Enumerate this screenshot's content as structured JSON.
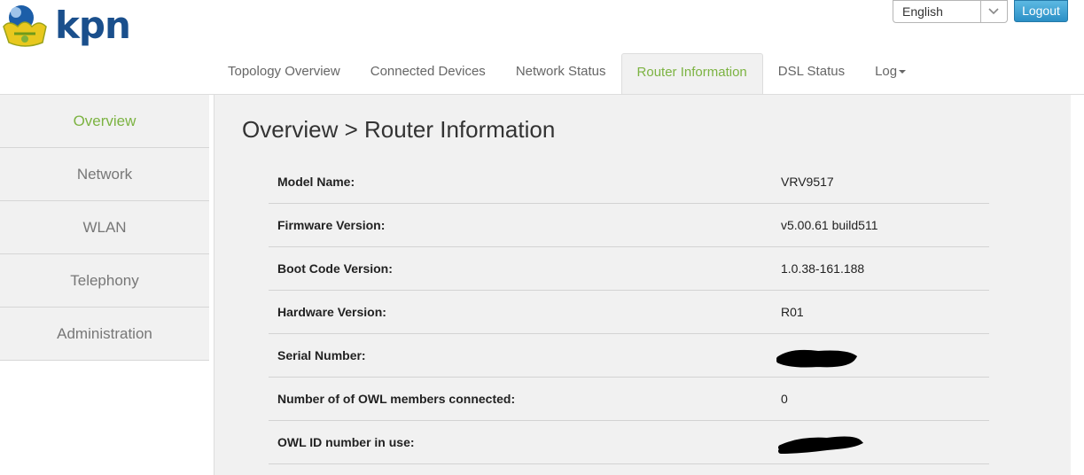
{
  "brand": {
    "name": "kpn"
  },
  "language": {
    "selected": "English"
  },
  "logout_label": "Logout",
  "tabs": [
    {
      "label": "Topology Overview"
    },
    {
      "label": "Connected Devices"
    },
    {
      "label": "Network Status"
    },
    {
      "label": "Router Information",
      "active": true
    },
    {
      "label": "DSL Status"
    },
    {
      "label": "Log"
    }
  ],
  "sidebar": {
    "items": [
      {
        "label": "Overview",
        "active": true
      },
      {
        "label": "Network"
      },
      {
        "label": "WLAN"
      },
      {
        "label": "Telephony"
      },
      {
        "label": "Administration"
      }
    ]
  },
  "page_title": "Overview > Router Information",
  "router_info": [
    {
      "label": "Model Name:",
      "value": "VRV9517"
    },
    {
      "label": "Firmware Version:",
      "value": "v5.00.61 build511"
    },
    {
      "label": "Boot Code Version:",
      "value": "1.0.38-161.188"
    },
    {
      "label": "Hardware Version:",
      "value": "R01"
    },
    {
      "label": "Serial Number:",
      "value": "",
      "redacted": true
    },
    {
      "label": "Number of of OWL members connected:",
      "value": "0"
    },
    {
      "label": "OWL ID number in use:",
      "value": "",
      "redacted": true
    }
  ],
  "colors": {
    "accent": "#7cb342",
    "brand": "#1a4f8c",
    "logout": "#2b8fc6"
  }
}
